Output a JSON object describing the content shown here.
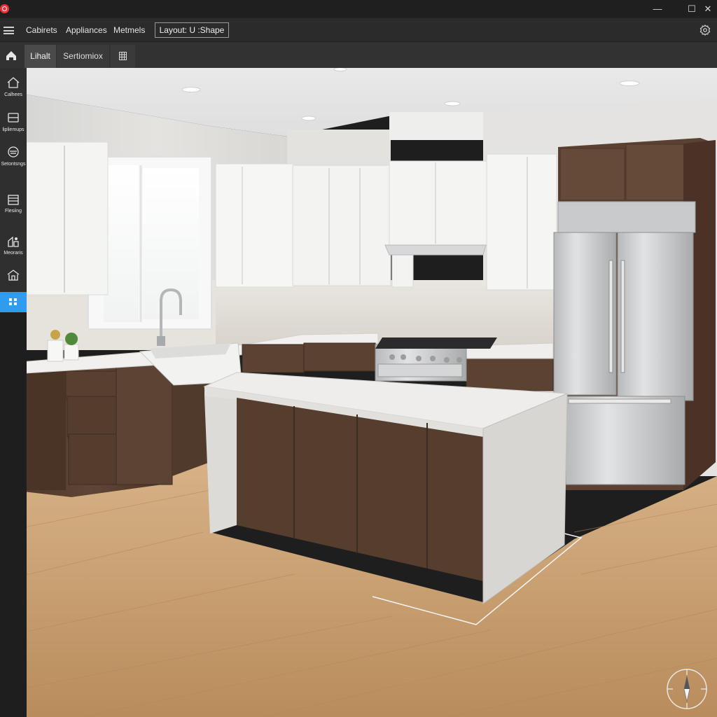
{
  "window": {
    "minimize_glyph": "—",
    "maximize_glyph": "☐",
    "close_glyph": "✕"
  },
  "menubar": {
    "items": [
      "Cabirets",
      "Appliances",
      "Metmels"
    ],
    "layout_button": "Layout: U :Shape"
  },
  "toolbar": {
    "tabs": [
      {
        "label": "Lihalt",
        "active": true
      },
      {
        "label": "Sertiomiox",
        "active": false
      }
    ]
  },
  "sidebar": {
    "items": [
      {
        "label": "Calhees",
        "icon": "cabinet-house-icon",
        "active": false
      },
      {
        "label": "lipliemups",
        "icon": "appliance-icon",
        "active": false
      },
      {
        "label": "Setontsngs",
        "icon": "stove-icon",
        "active": false
      },
      {
        "label": "Flesiing",
        "icon": "flooring-icon",
        "active": false
      },
      {
        "label": "Meoraris",
        "icon": "materials-icon",
        "active": false
      },
      {
        "label": "",
        "icon": "structure-icon",
        "active": false
      },
      {
        "label": "",
        "icon": "grid-dots-icon",
        "active": true
      }
    ]
  },
  "colors": {
    "accent": "#2f9cf0",
    "app_logo": "#e8323c",
    "cabinet_wood": "#5a4132",
    "floor_wood": "#c9a173"
  }
}
